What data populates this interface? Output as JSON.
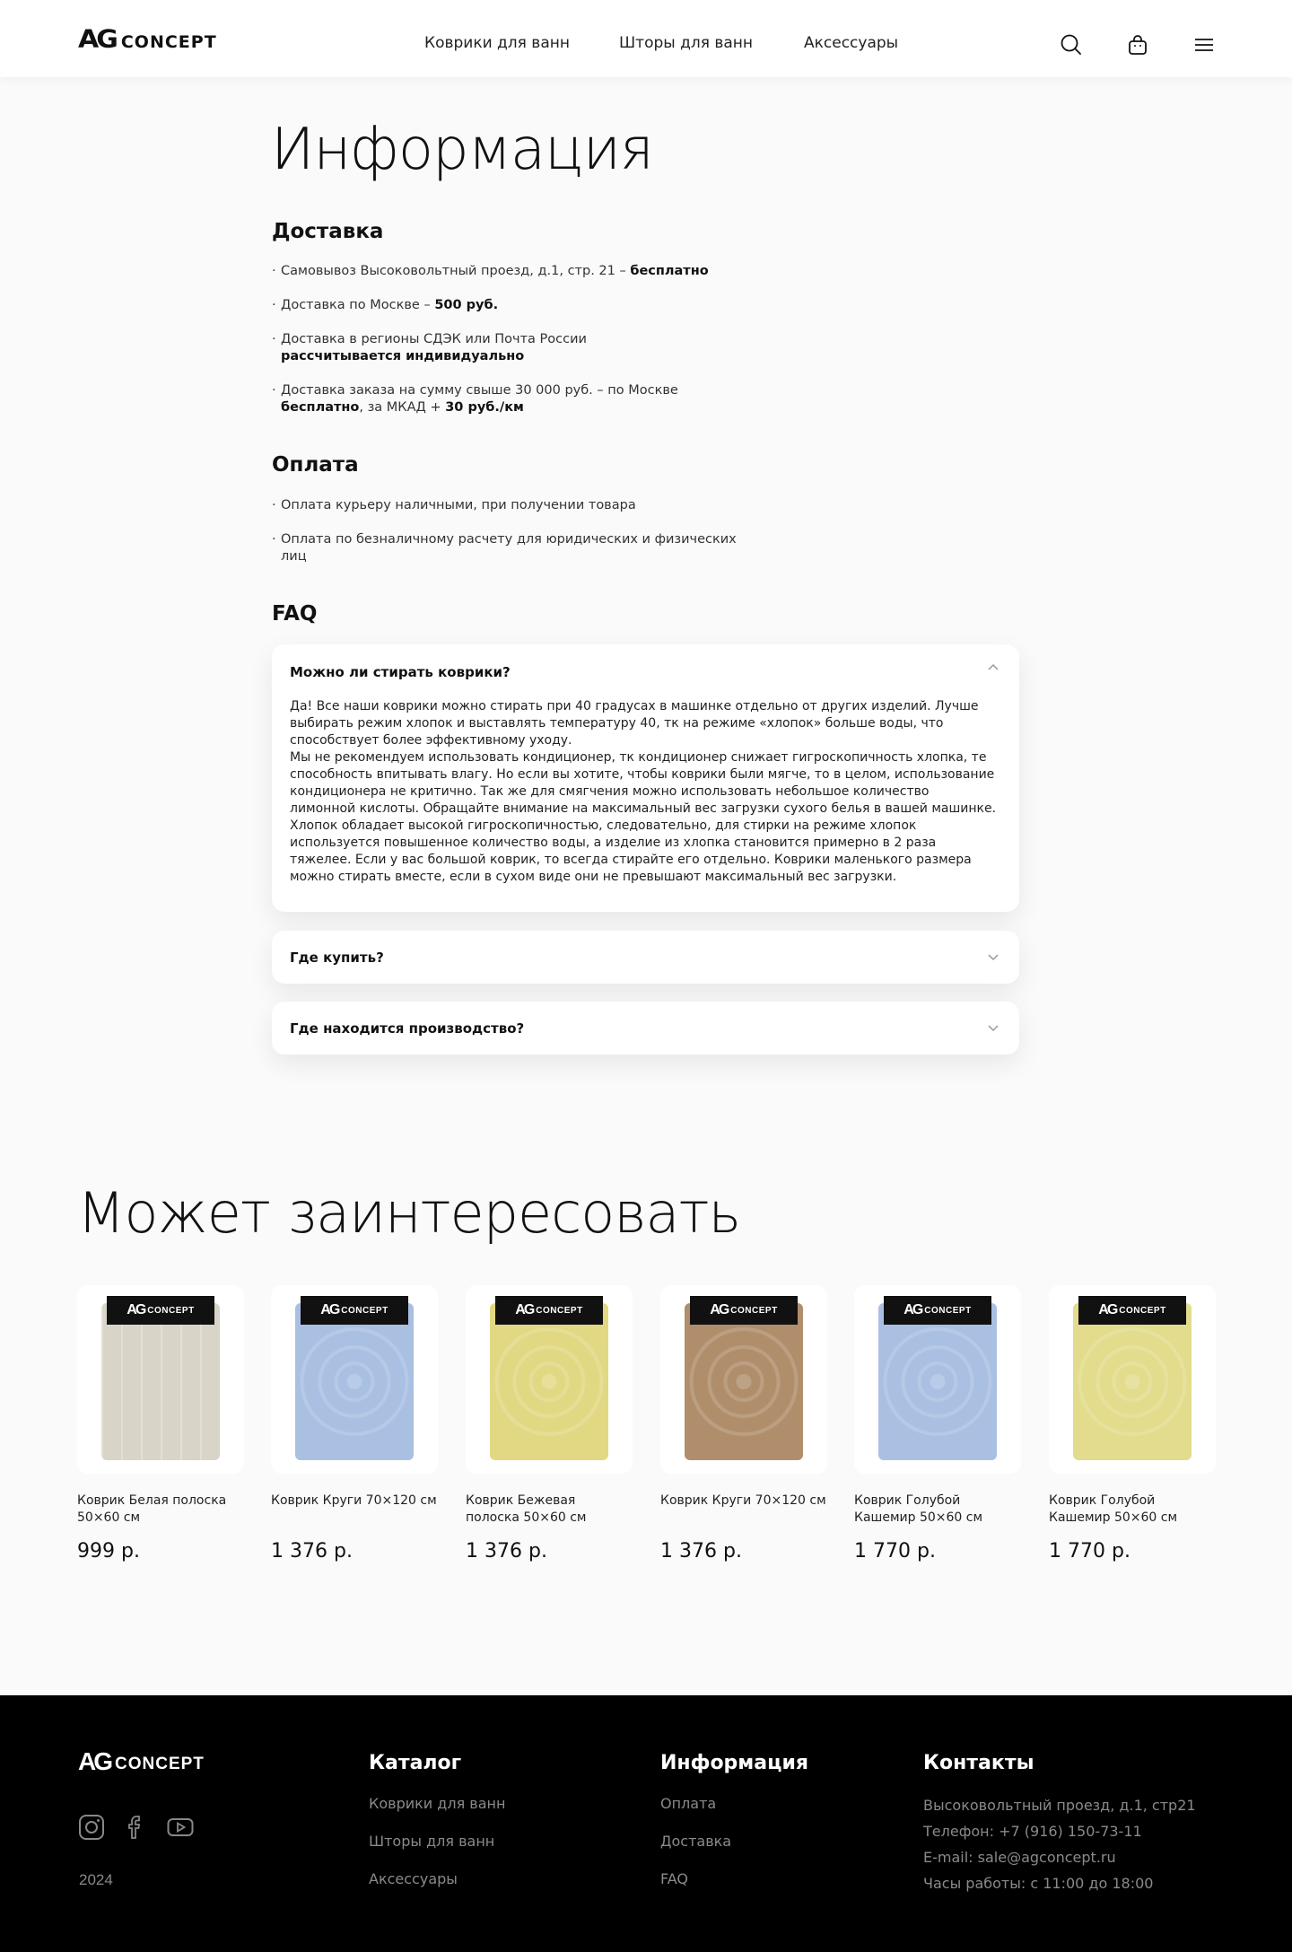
{
  "header": {
    "logo_ag": "AG",
    "logo_concept": "CONCEPT",
    "nav": [
      "Коврики для ванн",
      "Шторы для ванн",
      "Аксессуары"
    ],
    "icons": [
      "search-icon",
      "cart-icon",
      "menu-icon"
    ]
  },
  "info": {
    "title": "Информация",
    "delivery_title": "Доставка",
    "delivery": [
      {
        "text": "Самовывоз Высоковольтный проезд, д.1,  стр. 21 – ",
        "bold": "бесплатно",
        "tail": ""
      },
      {
        "text": "Доставка по Москве – ",
        "bold": "500 руб.",
        "tail": ""
      },
      {
        "text": "Доставка в регионы СДЭК или Почта России ",
        "bold": "рассчитывается индивидуально",
        "tail": ""
      },
      {
        "text": "Доставка заказа на сумму свыше 30 000 руб. – по Москве ",
        "bold": "бесплатно",
        "tail": ", за МКАД + ",
        "bold2": "30 руб./км"
      }
    ],
    "payment_title": "Оплата",
    "payment": [
      "Оплата курьеру наличными, при получении товара",
      "Оплата по безналичному расчету для юридических и физических лиц"
    ]
  },
  "faq": {
    "title": "FAQ",
    "items": [
      {
        "question": "Можно ли стирать коврики?",
        "expanded": true,
        "answer": "Да! Все наши коврики можно стирать при 40 градусах в машинке отдельно от других изделий. Лучше выбирать режим хлопок и выставлять температуру 40, тк на режиме «хлопок» больше воды, что способствует более эффективному уходу.\n Мы не рекомендуем использовать кондиционер, тк кондиционер снижает  гигроскопичность хлопка, те способность впитывать влагу. Но если вы  хотите, чтобы коврики были мягче, то в целом, использование кондиционера не критично. Так же для смягчения можно использовать небольшое  количество лимонной кислоты. Обращайте внимание на максимальный вес загрузки сухого белья в вашей  машинке. Хлопок обладает высокой гигроскопичностью, следовательно, для  стирки на режиме хлопок используется повышенное количество воды, а изделие из хлопка становится примерно в 2 раза тяжелее. Если у вас  большой коврик, то всегда стирайте его отдельно. Коврики маленького  размера можно стирать вместе, если в сухом виде они не превышают максимальный вес загрузки."
      },
      {
        "question": "Где купить?",
        "expanded": false
      },
      {
        "question": "Где находится производство?",
        "expanded": false
      }
    ]
  },
  "recommendations": {
    "title": "Может заинтересовать",
    "tag_ag": "AG",
    "tag_concept": "CONCEPT",
    "products": [
      {
        "name": "Коврик Белая полоска 50×60 см",
        "price": "999 р.",
        "color": "#d9d4c8"
      },
      {
        "name": "Коврик Круги 70×120 см",
        "price": "1 376 р.",
        "color": "#a9c0e3"
      },
      {
        "name": "Коврик Бежевая полоска 50×60 см",
        "price": "1 376 р.",
        "color": "#e2d884"
      },
      {
        "name": "Коврик Круги 70×120 см",
        "price": "1 376 р.",
        "color": "#b08e6c"
      },
      {
        "name": "Коврик Голубой Кашемир 50×60 см",
        "price": "1 770 р.",
        "color": "#a9c0e3"
      },
      {
        "name": "Коврик Голубой Кашемир 50×60 см",
        "price": "1 770 р.",
        "color": "#e2dc8c"
      }
    ]
  },
  "footer": {
    "logo_ag": "AG",
    "logo_concept": "CONCEPT",
    "social": [
      "instagram-icon",
      "facebook-icon",
      "youtube-icon"
    ],
    "year": "2024",
    "catalog_title": "Каталог",
    "catalog": [
      "Коврики для ванн",
      "Шторы для ванн",
      "Аксессуары"
    ],
    "info_title": "Информация",
    "info": [
      "Оплата",
      "Доставка",
      "FAQ"
    ],
    "contacts_title": "Контакты",
    "contacts": [
      "Высоковольтный проезд, д.1,  стр21",
      "Телефон: +7 (916) 150-73-11",
      "E-mail: sale@agconcept.ru",
      "Часы работы:  с 11:00 до 18:00"
    ]
  }
}
